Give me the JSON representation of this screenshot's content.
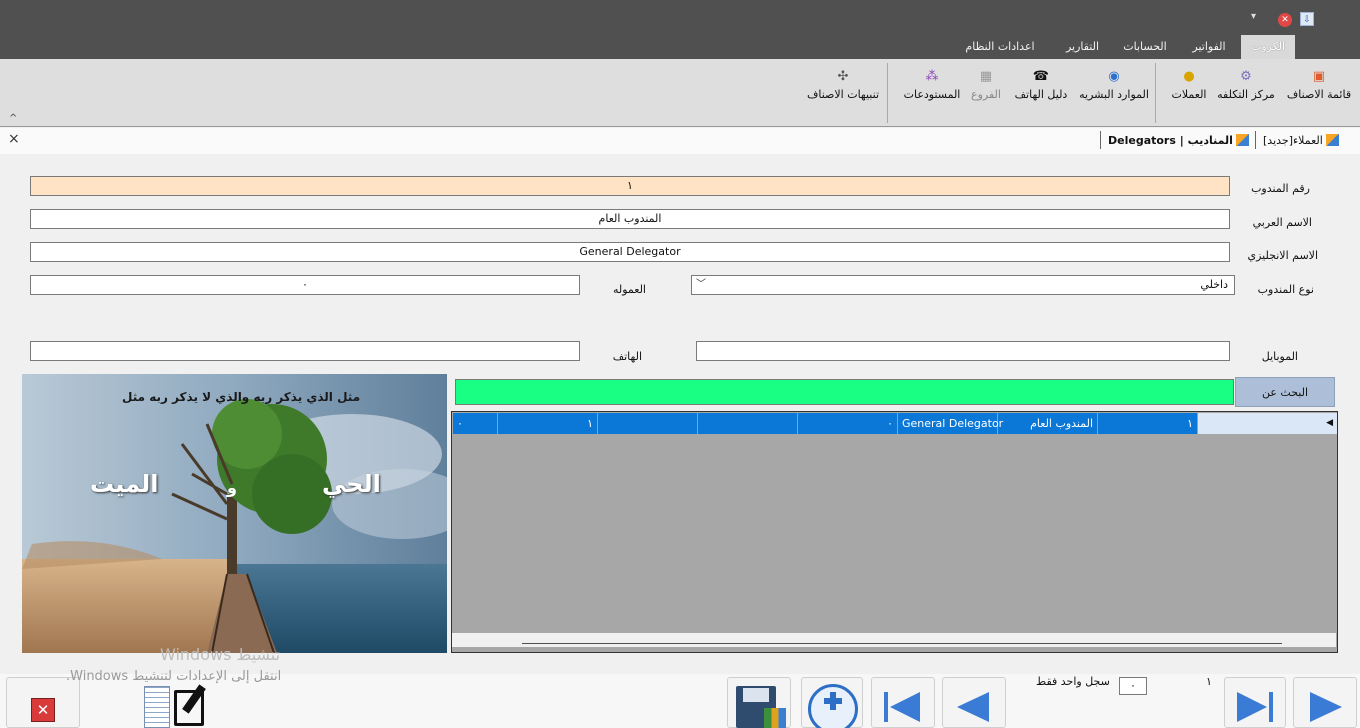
{
  "window": {
    "controls": [
      "▾",
      "✕",
      "⇩"
    ]
  },
  "tabs": [
    {
      "label": "الكروت",
      "active": true
    },
    {
      "label": "الفواتير"
    },
    {
      "label": "الحسابات"
    },
    {
      "label": "التقارير"
    },
    {
      "label": "اعدادات النظام"
    }
  ],
  "ribbon": {
    "items_list": "قائمة الاصناف",
    "cost_center": "مركز التكلفه",
    "currencies": "العملات",
    "hr": "الموارد البشريه",
    "phone_book": "دليل الهاتف",
    "branches": "الفروع",
    "warehouses": "المستودعات",
    "item_alerts": "تنبيهات الاصناف",
    "collapse": "^"
  },
  "doc_tabs": {
    "customers": "العملاء[جديد]",
    "delegators": "المناديب | Delegators",
    "close": "×"
  },
  "form": {
    "delegate_no_label": "رقم المندوب",
    "delegate_no": "١",
    "arabic_name_label": "الاسم العربي",
    "arabic_name": "المندوب العام",
    "english_name_label": "الاسم الانجليزي",
    "english_name": "General Delegator",
    "type_label": "نوع  المندوب",
    "type_value": "داخلي",
    "commission_label": "العموله",
    "commission": "٠",
    "mobile_label": "الموبايل",
    "mobile": "",
    "phone_label": "الهاتف",
    "phone": "",
    "search_label": "البحث عن",
    "search_value": ""
  },
  "grid": {
    "row": [
      "١",
      "المندوب العام",
      "General Delegator",
      "٠",
      "",
      "",
      "١",
      "٠"
    ]
  },
  "banner": {
    "top_text": "مثل الذي يذكر ربه والذي لا يذكر ربه مثل",
    "alive": "الحي",
    "and": "و",
    "dead": "الميت",
    "colors": {
      "sky": "#6f8fae",
      "sea": "#2d5a78",
      "sand": "#c9a27a"
    }
  },
  "bottom": {
    "record_label": "سجل واحد فقط",
    "record_value": "٠",
    "counter": "١",
    "watermark_title": "تنشيط Windows",
    "watermark_sub": "انتقل إلى الإعدادات لتنشيط Windows."
  },
  "colors": {
    "selected_row": "#0b78d7",
    "search_field": "#19ff84",
    "id_field": "#ffe3c4"
  }
}
